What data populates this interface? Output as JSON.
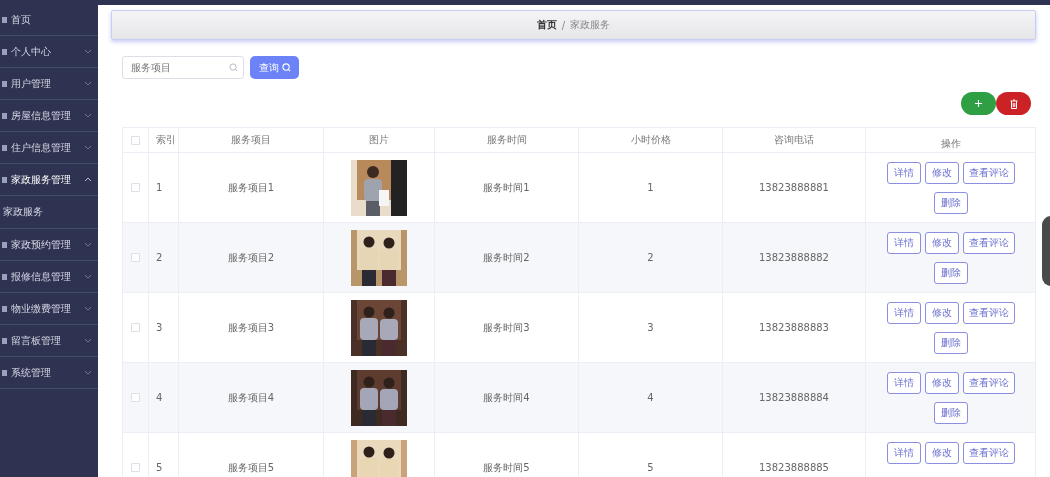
{
  "sidebar": {
    "items": [
      {
        "label": "首页"
      },
      {
        "label": "个人中心",
        "expanded": false
      },
      {
        "label": "用户管理",
        "expanded": false
      },
      {
        "label": "房屋信息管理",
        "expanded": false
      },
      {
        "label": "住户信息管理",
        "expanded": false
      },
      {
        "label": "家政服务管理",
        "expanded": true,
        "children": [
          {
            "label": "家政服务"
          }
        ]
      },
      {
        "label": "家政预约管理",
        "expanded": false
      },
      {
        "label": "报修信息管理",
        "expanded": false
      },
      {
        "label": "物业缴费管理",
        "expanded": false
      },
      {
        "label": "留言板管理",
        "expanded": false
      },
      {
        "label": "系统管理",
        "expanded": false
      }
    ]
  },
  "breadcrumb": {
    "items": [
      "首页",
      "家政服务"
    ],
    "separator": "/"
  },
  "search": {
    "placeholder": "服务项目",
    "button": "查询"
  },
  "table": {
    "all_checked": false,
    "columns": [
      "索引",
      "服务项目",
      "图片",
      "服务时间",
      "小时价格",
      "咨询电话",
      "操作"
    ],
    "rows": [
      {
        "index": "1",
        "item": "服务项目1",
        "picture": {
          "kind": "picture"
        },
        "time": "服务时间1",
        "price": "1",
        "phone": "13823888881",
        "checked": false,
        "actions": [
          "详情",
          "修改",
          "查看评论",
          "删除"
        ]
      },
      {
        "index": "2",
        "item": "服务项目2",
        "picture": {
          "kind": "picture"
        },
        "time": "服务时间2",
        "price": "2",
        "phone": "13823888882",
        "checked": false,
        "actions": [
          "详情",
          "修改",
          "查看评论",
          "删除"
        ]
      },
      {
        "index": "3",
        "item": "服务项目3",
        "picture": {
          "kind": "picture"
        },
        "time": "服务时间3",
        "price": "3",
        "phone": "13823888883",
        "checked": false,
        "actions": [
          "详情",
          "修改",
          "查看评论",
          "删除"
        ]
      },
      {
        "index": "4",
        "item": "服务项目4",
        "picture": {
          "kind": "picture"
        },
        "time": "服务时间4",
        "price": "4",
        "phone": "13823888884",
        "checked": false,
        "actions": [
          "详情",
          "修改",
          "查看评论",
          "删除"
        ]
      },
      {
        "index": "5",
        "item": "服务项目5",
        "picture": {
          "kind": "picture"
        },
        "time": "服务时间5",
        "price": "5",
        "phone": "13823888885",
        "checked": false,
        "actions": [
          "详情",
          "修改",
          "查看评论"
        ]
      }
    ]
  }
}
